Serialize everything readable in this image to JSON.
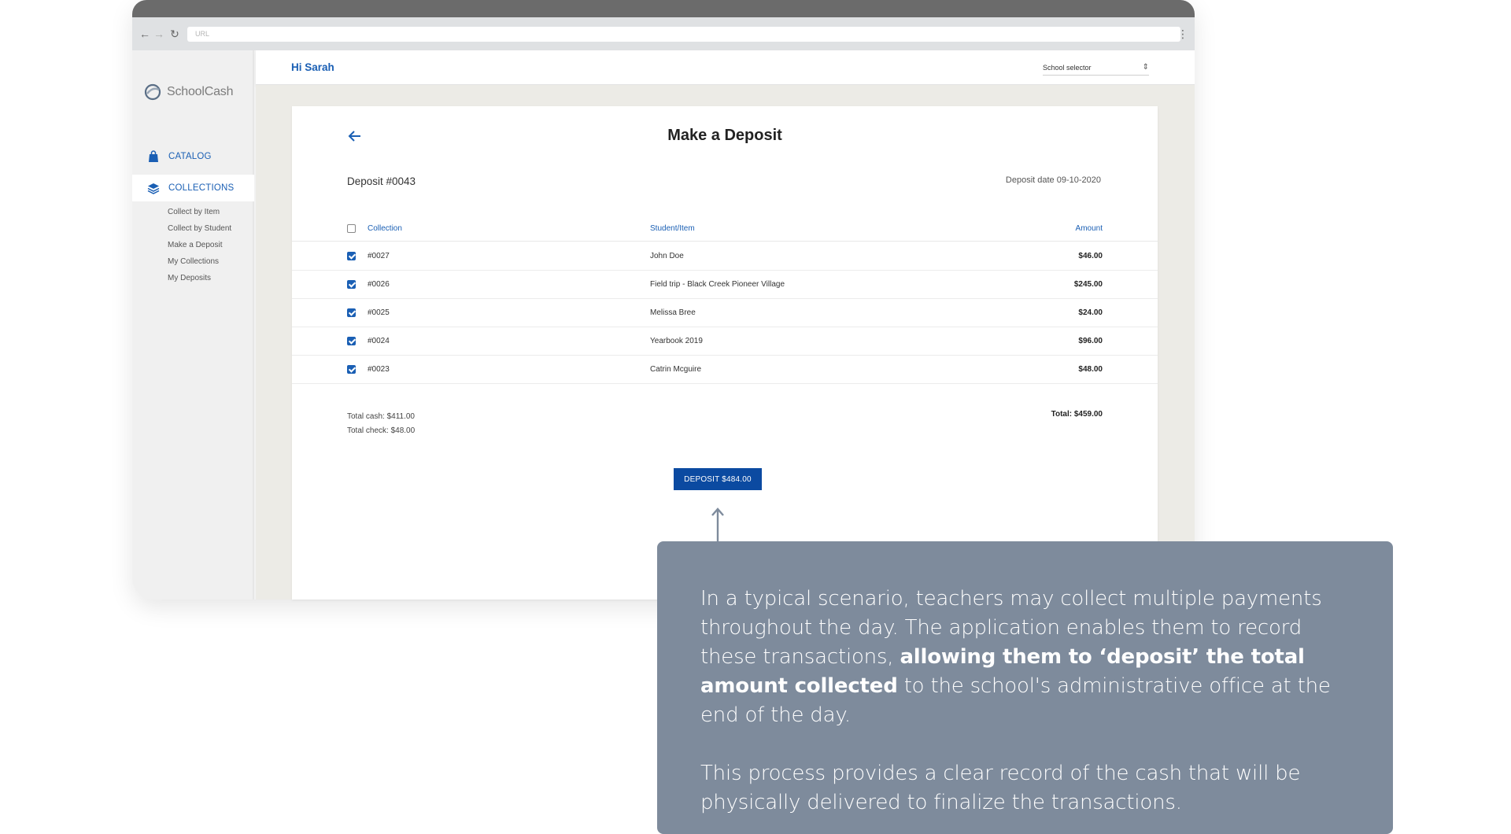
{
  "browser": {
    "url_placeholder": "URL"
  },
  "sidebar": {
    "logo_text": "SchoolCash",
    "items": [
      {
        "label": "CATALOG",
        "icon": "shopping-bag-icon"
      },
      {
        "label": "COLLECTIONS",
        "icon": "layers-icon"
      }
    ],
    "sub_items": [
      "Collect by Item",
      "Collect by Student",
      "Make a Deposit",
      "My Collections",
      "My Deposits"
    ]
  },
  "header": {
    "greeting": "Hi Sarah",
    "school_selector_label": "School selector"
  },
  "page": {
    "title": "Make a Deposit",
    "deposit_number": "Deposit #0043",
    "deposit_date": "Deposit date 09-10-2020",
    "columns": [
      "Collection",
      "Student/Item",
      "Amount"
    ],
    "rows": [
      {
        "collection": "#0027",
        "item": "John Doe",
        "amount": "$46.00",
        "checked": true
      },
      {
        "collection": "#0026",
        "item": "Field trip - Black Creek Pioneer Village",
        "amount": "$245.00",
        "checked": true
      },
      {
        "collection": "#0025",
        "item": "Melissa Bree",
        "amount": "$24.00",
        "checked": true
      },
      {
        "collection": "#0024",
        "item": "Yearbook 2019",
        "amount": "$96.00",
        "checked": true
      },
      {
        "collection": "#0023",
        "item": "Catrin Mcguire",
        "amount": "$48.00",
        "checked": true
      }
    ],
    "total_cash": "Total cash: $411.00",
    "total_check": "Total check: $48.00",
    "total": "Total: $459.00",
    "deposit_button": "DEPOSIT $484.00"
  },
  "annotation": {
    "p1_start": "In a typical scenario, teachers may collect multiple payments throughout the day. The application enables them to record these transactions, ",
    "p1_bold": "allowing them to ‘deposit’ the total amount collected",
    "p1_end": " to the school's administrative office at the end of the day.",
    "p2": "This process provides a clear record of the cash that will be physically delivered to finalize the transactions."
  },
  "colors": {
    "accent": "#1a5fb4",
    "button": "#0b4aa1",
    "callout": "#7e8b9c"
  }
}
